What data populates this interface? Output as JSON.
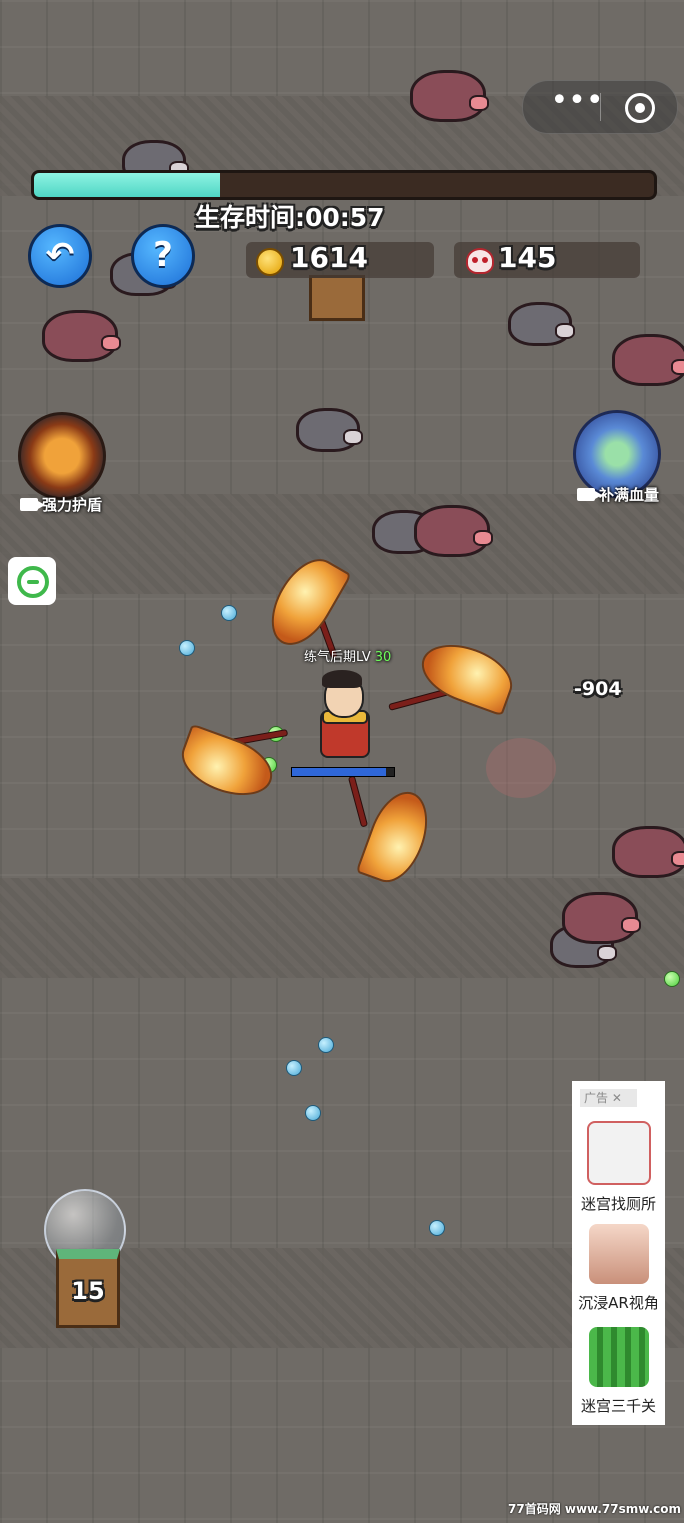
{
  "hud": {
    "survival_label": "生存时间:",
    "survival_time": "00:57",
    "progress_fraction": 0.3,
    "coins": "1614",
    "kills": "145"
  },
  "buttons": {
    "back_icon": "↶",
    "help_icon": "?"
  },
  "skills": {
    "shield_label": "强力护盾",
    "heal_label": "补满血量"
  },
  "player": {
    "title": "练气后期LV",
    "level": "30",
    "hp_fraction": 0.92
  },
  "damage_popup": "-904",
  "weapon_slot": {
    "count": "15"
  },
  "ad": {
    "tag": "广告",
    "close_icon": "✕",
    "items": [
      {
        "label": "迷宫找厕所"
      },
      {
        "label": "沉浸AR视角"
      },
      {
        "label": "迷宫三千关"
      }
    ]
  },
  "watermark": "77首码网 www.77smw.com",
  "colors": {
    "progress_fill": "#4fd6c4",
    "button_blue": "#1c6ed6",
    "level_green": "#6dff5a",
    "hp_blue": "#2f67d8"
  }
}
